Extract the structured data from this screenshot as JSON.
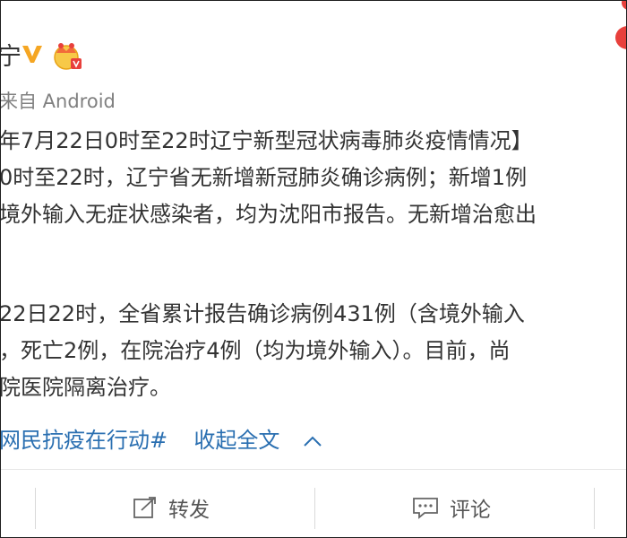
{
  "post": {
    "author_name": "宁",
    "source": "来自 Android",
    "lines": [
      "年7月22日0时至22时辽宁新型冠状病毒肺炎疫情情况】",
      "0时至22时，辽宁省无新增新冠肺炎确诊病例；新增1例",
      "境外输入无症状感染者，均为沈阳市报告。无新增治愈出",
      "22日22时，全省累计报告确诊病例431例（含境外输入",
      "，死亡2例，在院治疗4例（均为境外输入）。目前，尚",
      "院医院隔离治疗。"
    ],
    "hashtag": "网民抗疫在行动#",
    "collapse_label": "收起全文"
  },
  "actions": {
    "repost_label": "转发",
    "comment_label": "评论"
  },
  "colors": {
    "link": "#2a6fb1",
    "verified": "#f5a623",
    "text": "#333333",
    "secondary": "#808080"
  },
  "icons": [
    "verified-icon",
    "crown-member-icon",
    "chevron-up-icon",
    "repost-icon",
    "comment-icon"
  ]
}
